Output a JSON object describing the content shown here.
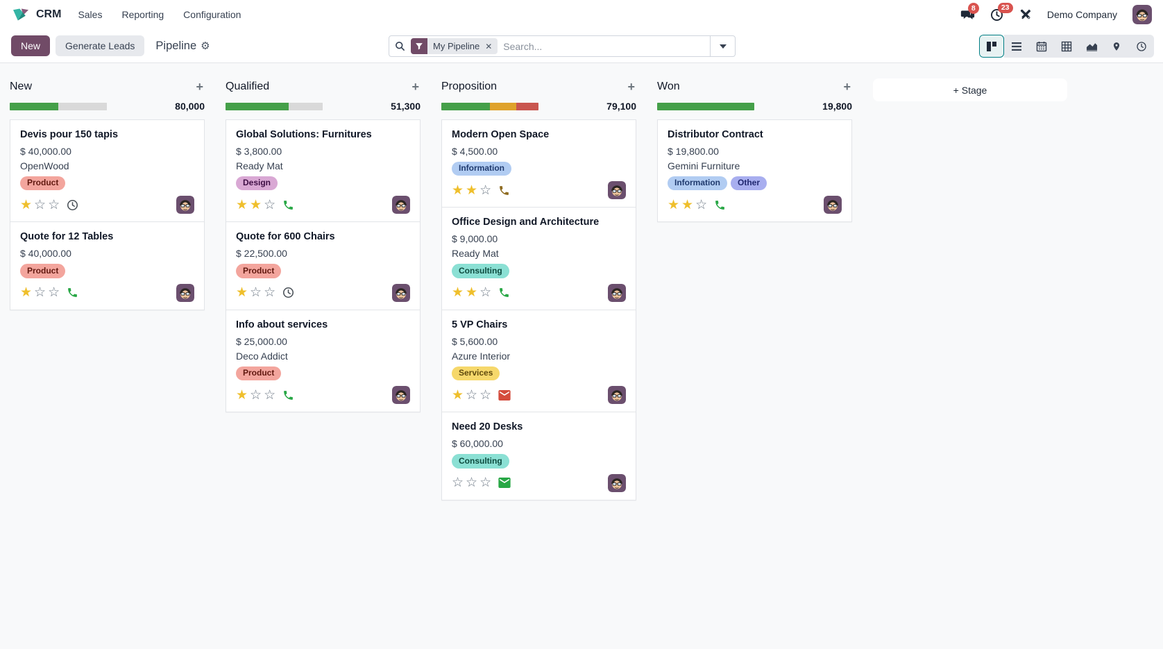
{
  "navbar": {
    "app_name": "CRM",
    "menus": [
      {
        "label": "Sales"
      },
      {
        "label": "Reporting"
      },
      {
        "label": "Configuration"
      }
    ],
    "messages_badge": "8",
    "activities_badge": "23",
    "company_name": "Demo Company"
  },
  "control_panel": {
    "new_button": "New",
    "generate_leads_button": "Generate Leads",
    "page_title": "Pipeline",
    "filter_chip": "My Pipeline",
    "search_placeholder": "Search...",
    "add_stage_button": "+ Stage"
  },
  "colors": {
    "accent": "#714B67",
    "badge_red": "#d9534f",
    "progress": {
      "green": "#45a049",
      "orange": "#dfa22b",
      "red": "#c9564f",
      "gray": "#d9d9d9"
    },
    "activity": {
      "green": "#28a745",
      "brown": "#8f6c22",
      "red": "#d44c3d",
      "gray": "#495057"
    }
  },
  "board": {
    "columns": [
      {
        "name": "New",
        "total": "80,000",
        "progress": [
          {
            "color": "green",
            "pct": 50
          },
          {
            "color": "gray",
            "pct": 50
          }
        ],
        "cards": [
          {
            "title": "Devis pour 150 tapis",
            "amount": "$ 40,000.00",
            "company": "OpenWood",
            "tags": [
              {
                "label": "Product",
                "color": "red"
              }
            ],
            "stars": 1,
            "activity": {
              "icon": "clock",
              "color": "gray"
            }
          },
          {
            "title": "Quote for 12 Tables",
            "amount": "$ 40,000.00",
            "company": "",
            "tags": [
              {
                "label": "Product",
                "color": "red"
              }
            ],
            "stars": 1,
            "activity": {
              "icon": "phone",
              "color": "green"
            }
          }
        ]
      },
      {
        "name": "Qualified",
        "total": "51,300",
        "progress": [
          {
            "color": "green",
            "pct": 65
          },
          {
            "color": "gray",
            "pct": 35
          }
        ],
        "cards": [
          {
            "title": "Global Solutions: Furnitures",
            "amount": "$ 3,800.00",
            "company": "Ready Mat",
            "tags": [
              {
                "label": "Design",
                "color": "purple"
              }
            ],
            "stars": 2,
            "activity": {
              "icon": "phone",
              "color": "green"
            }
          },
          {
            "title": "Quote for 600 Chairs",
            "amount": "$ 22,500.00",
            "company": "",
            "tags": [
              {
                "label": "Product",
                "color": "red"
              }
            ],
            "stars": 1,
            "activity": {
              "icon": "clock",
              "color": "gray"
            }
          },
          {
            "title": "Info about services",
            "amount": "$ 25,000.00",
            "company": "Deco Addict",
            "tags": [
              {
                "label": "Product",
                "color": "red"
              }
            ],
            "stars": 1,
            "activity": {
              "icon": "phone",
              "color": "green"
            }
          }
        ]
      },
      {
        "name": "Proposition",
        "total": "79,100",
        "progress": [
          {
            "color": "green",
            "pct": 50
          },
          {
            "color": "orange",
            "pct": 27
          },
          {
            "color": "red",
            "pct": 23
          }
        ],
        "cards": [
          {
            "title": "Modern Open Space",
            "amount": "$ 4,500.00",
            "company": "",
            "tags": [
              {
                "label": "Information",
                "color": "blue"
              }
            ],
            "stars": 2,
            "activity": {
              "icon": "phone",
              "color": "brown"
            }
          },
          {
            "title": "Office Design and Architecture",
            "amount": "$ 9,000.00",
            "company": "Ready Mat",
            "tags": [
              {
                "label": "Consulting",
                "color": "teal"
              }
            ],
            "stars": 2,
            "activity": {
              "icon": "phone",
              "color": "green"
            }
          },
          {
            "title": "5 VP Chairs",
            "amount": "$ 5,600.00",
            "company": "Azure Interior",
            "tags": [
              {
                "label": "Services",
                "color": "yellow"
              }
            ],
            "stars": 1,
            "activity": {
              "icon": "envelope",
              "color": "red"
            }
          },
          {
            "title": "Need 20 Desks",
            "amount": "$ 60,000.00",
            "company": "",
            "tags": [
              {
                "label": "Consulting",
                "color": "teal"
              }
            ],
            "stars": 0,
            "activity": {
              "icon": "envelope",
              "color": "green"
            }
          }
        ]
      },
      {
        "name": "Won",
        "total": "19,800",
        "progress": [
          {
            "color": "green",
            "pct": 100
          }
        ],
        "cards": [
          {
            "title": "Distributor Contract",
            "amount": "$ 19,800.00",
            "company": "Gemini Furniture",
            "tags": [
              {
                "label": "Information",
                "color": "blue"
              },
              {
                "label": "Other",
                "color": "indigo"
              }
            ],
            "stars": 2,
            "activity": {
              "icon": "phone",
              "color": "green"
            }
          }
        ]
      }
    ]
  }
}
